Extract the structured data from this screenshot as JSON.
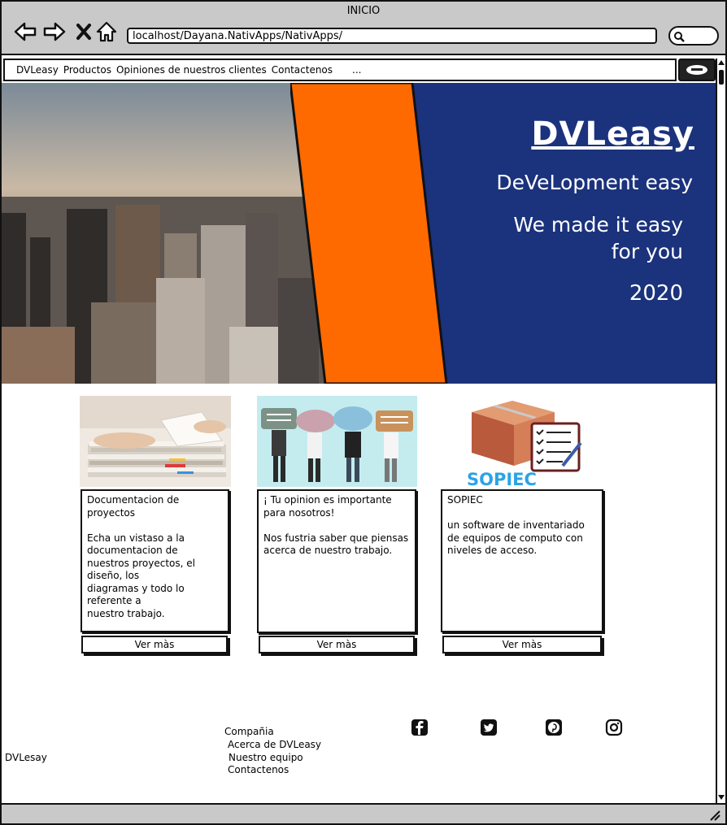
{
  "window": {
    "title": "INICIO"
  },
  "browser": {
    "url": "localhost/Dayana.NativApps/NativApps/",
    "back_icon": "arrow-left-icon",
    "forward_icon": "arrow-right-icon",
    "close_icon": "x-icon",
    "home_icon": "home-icon",
    "search_icon": "magnifier-icon"
  },
  "menu": {
    "items": [
      "DVLeasy",
      "Productos",
      "Opiniones de nuestros clientes",
      "Contactenos"
    ],
    "more": "..."
  },
  "hero": {
    "brand": "DVLeasy",
    "tagline": "DeVeLopment easy",
    "slogan_line1": "We made it easy",
    "slogan_line2": "for you",
    "year": "2020",
    "colors": {
      "panel": "#1b327c",
      "stripe": "#ff6a00"
    }
  },
  "cards": [
    {
      "text": "Documentacion de\nproyectos\n\nEcha un vistaso a la\ndocumentacion de\n nuestros proyectos, el\ndiseño, los\ndiagramas y todo lo\nreferente a\nnuestro trabajo.",
      "button": "Ver màs"
    },
    {
      "text": "¡ Tu opinion es importante\npara nosotros!\n\nNos fustria saber que piensas\nacerca de nuestro trabajo.",
      "button": "Ver màs"
    },
    {
      "image_label": "SOPIEC",
      "text": "SOPIEC\n\nun software de inventariado\nde equipos de computo con\nniveles de acceso.",
      "button": "Ver màs"
    }
  ],
  "footer": {
    "brand": "DVLesay",
    "column_title": "Compañia",
    "links": [
      "Acerca de DVLeasy",
      "Nuestro equipo",
      "Contactenos"
    ],
    "social_icons": [
      "facebook-icon",
      "twitter-icon",
      "pinterest-icon",
      "instagram-icon"
    ]
  }
}
